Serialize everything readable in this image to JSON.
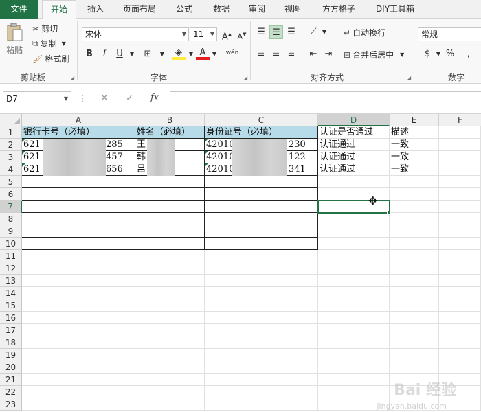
{
  "tabs": [
    "文件",
    "开始",
    "插入",
    "页面布局",
    "公式",
    "数据",
    "审阅",
    "视图",
    "方方格子",
    "DIY工具箱"
  ],
  "clipboard": {
    "paste": "粘贴",
    "cut": "剪切",
    "copy": "复制",
    "format_painter": "格式刷",
    "label": "剪贴板"
  },
  "font": {
    "name": "宋体",
    "size": "11",
    "label": "字体",
    "bold": "B",
    "italic": "I",
    "underline": "U",
    "grow": "A",
    "shrink": "A",
    "fontcolor": "A",
    "wen": "wén"
  },
  "alignment": {
    "wrap": "自动换行",
    "merge": "合并后居中",
    "label": "对齐方式"
  },
  "number": {
    "format": "常规",
    "label": "数字",
    "currency": "$",
    "percent": "%"
  },
  "formula_bar": {
    "name_box": "D7",
    "cancel": "✕",
    "enter": "✓",
    "fx": "fx",
    "content": ""
  },
  "columns": [
    "A",
    "B",
    "C",
    "D",
    "E",
    "F"
  ],
  "rows": [
    "1",
    "2",
    "3",
    "4",
    "5",
    "6",
    "7",
    "8",
    "9",
    "10",
    "11",
    "12",
    "13",
    "14",
    "15",
    "16",
    "17",
    "18",
    "19",
    "20",
    "21",
    "22",
    "23"
  ],
  "selected_cell": "D7",
  "sheet": {
    "header": [
      "银行卡号（必填）",
      "姓名（必填）",
      "身份证号（必填）",
      "认证是否通过",
      "描述"
    ],
    "data": [
      {
        "card_start": "621",
        "card_end": "285",
        "name": "王",
        "id_start": "42010",
        "id_end": "230",
        "status": "认证通过",
        "desc": "一致"
      },
      {
        "card_start": "621",
        "card_end": "457",
        "name": "韩",
        "id_start": "42010",
        "id_end": "122",
        "status": "认证通过",
        "desc": "一致"
      },
      {
        "card_start": "621",
        "card_end": "656",
        "name": "吕",
        "id_start": "42010",
        "id_end": "341",
        "status": "认证通过",
        "desc": "一致"
      }
    ]
  },
  "watermark": {
    "main": "Bai 经验",
    "sub": "jingyan.baidu.com"
  }
}
